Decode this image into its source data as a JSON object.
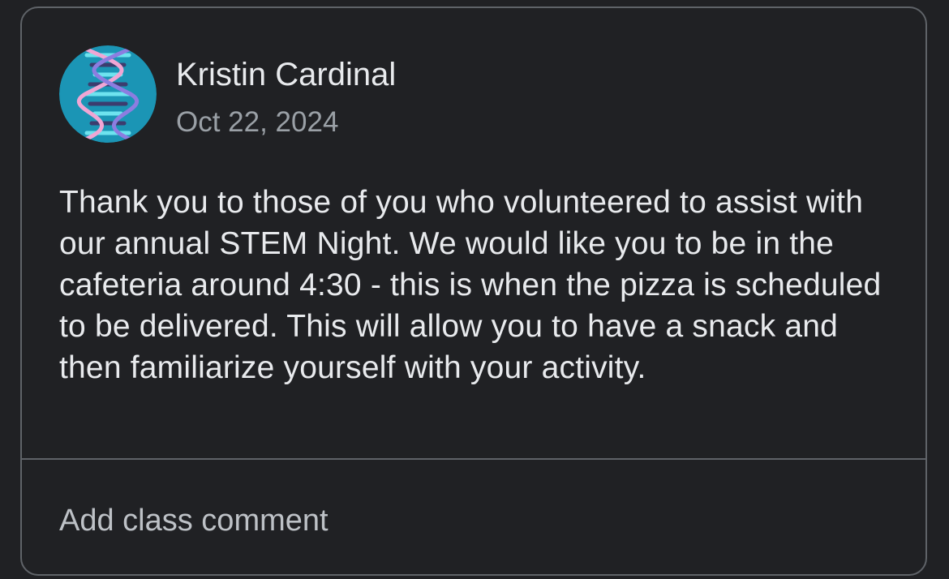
{
  "post": {
    "author": "Kristin Cardinal",
    "date": "Oct 22, 2024",
    "body": "Thank you to those of you who volunteered to assist with our annual STEM Night. We would like you to be in the cafeteria around 4:30 - this is when the pizza is scheduled to be delivered. This will allow you to have a snack and then familiarize yourself with your activity.",
    "avatar_icon": "dna-helix-icon"
  },
  "comment": {
    "placeholder": "Add class comment"
  },
  "colors": {
    "background": "#202124",
    "border": "#5f6368",
    "text_primary": "#e8eaed",
    "text_secondary": "#9aa0a6",
    "avatar_bg": "#1b95b5"
  }
}
